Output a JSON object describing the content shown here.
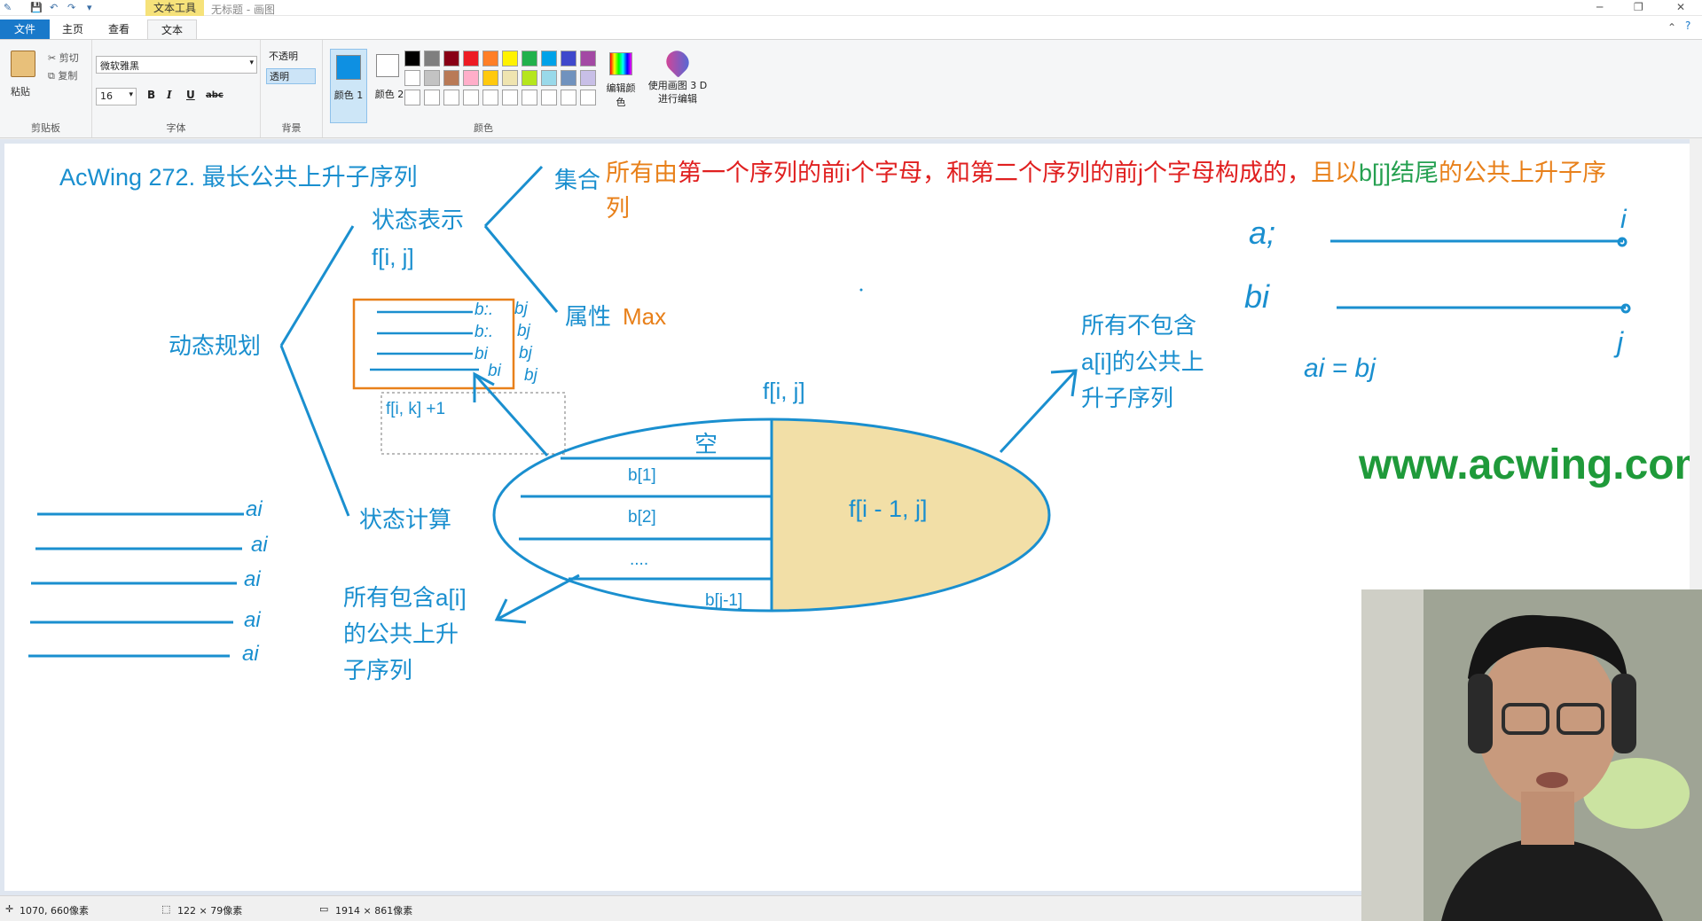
{
  "title_bar": {
    "context_tab": "文本工具",
    "window_title": "无标题 - 画图"
  },
  "tabs": [
    {
      "label": "文件"
    },
    {
      "label": "主页"
    },
    {
      "label": "查看"
    },
    {
      "label": "文本"
    }
  ],
  "ribbon": {
    "clipboard": {
      "paste": "粘贴",
      "cut": "剪切",
      "copy": "复制",
      "group": "剪贴板"
    },
    "font": {
      "family": "微软雅黑",
      "size": "16",
      "group": "字体"
    },
    "background": {
      "opaque": "不透明",
      "transparent": "透明",
      "group": "背景"
    },
    "colors": {
      "color1": "颜色 1",
      "color2": "颜色 2",
      "edit": "编辑颜色",
      "group": "颜色"
    },
    "paint3d": {
      "label": "使用画图 3 D 进行编辑"
    },
    "palette": [
      "#000000",
      "#7f7f7f",
      "#880015",
      "#ed1c24",
      "#ff7f27",
      "#fff200",
      "#22b14c",
      "#00a2e8",
      "#3f48cc",
      "#a349a4",
      "#ffffff",
      "#c3c3c3",
      "#b97a57",
      "#ffaec9",
      "#ffc90e",
      "#efe4b0",
      "#b5e61d",
      "#99d9ea",
      "#7092be",
      "#c8bfe7"
    ]
  },
  "drawing": {
    "title": "AcWing 272. 最长公共上升子序列",
    "dp_root": "动态规划",
    "state_repr": "状态表示",
    "state_fn": "f[i, j]",
    "set_label": "集合",
    "set_desc_1": "所有由",
    "set_desc_2": "第一个序列的前i个字母，和第二个序列的前j个字母构成的，",
    "set_desc_3": "且以",
    "set_desc_4": "b[j]结尾",
    "set_desc_5": "的公共上升子序",
    "set_desc_6": "列",
    "attr_label": "属性",
    "attr_value": "Max",
    "state_calc": "状态计算",
    "ellipse_title": "f[i, j]",
    "left_empty": "空",
    "left_b1": "b[1]",
    "left_b2": "b[2]",
    "left_dots": "....",
    "left_bj1": "b[j-1]",
    "right_part": "f[i - 1, j]",
    "fk_label": "f[i, k] +1",
    "not_contain_1": "所有不包含",
    "not_contain_2": "a[i]的公共上",
    "not_contain_3": "升子序列",
    "contain_1": "所有包含a[i]",
    "contain_2": "的公共上升",
    "contain_3": "子序列",
    "watermark": "www.acwing.com",
    "hw_ai": "a;",
    "hw_bi": "bi",
    "hw_i": "i",
    "hw_j": "j",
    "hw_eq": "ai = bj"
  },
  "status": {
    "cursor": "1070, 660像素",
    "selection": "122 × 79像素",
    "canvas_size": "1914 × 861像素"
  }
}
